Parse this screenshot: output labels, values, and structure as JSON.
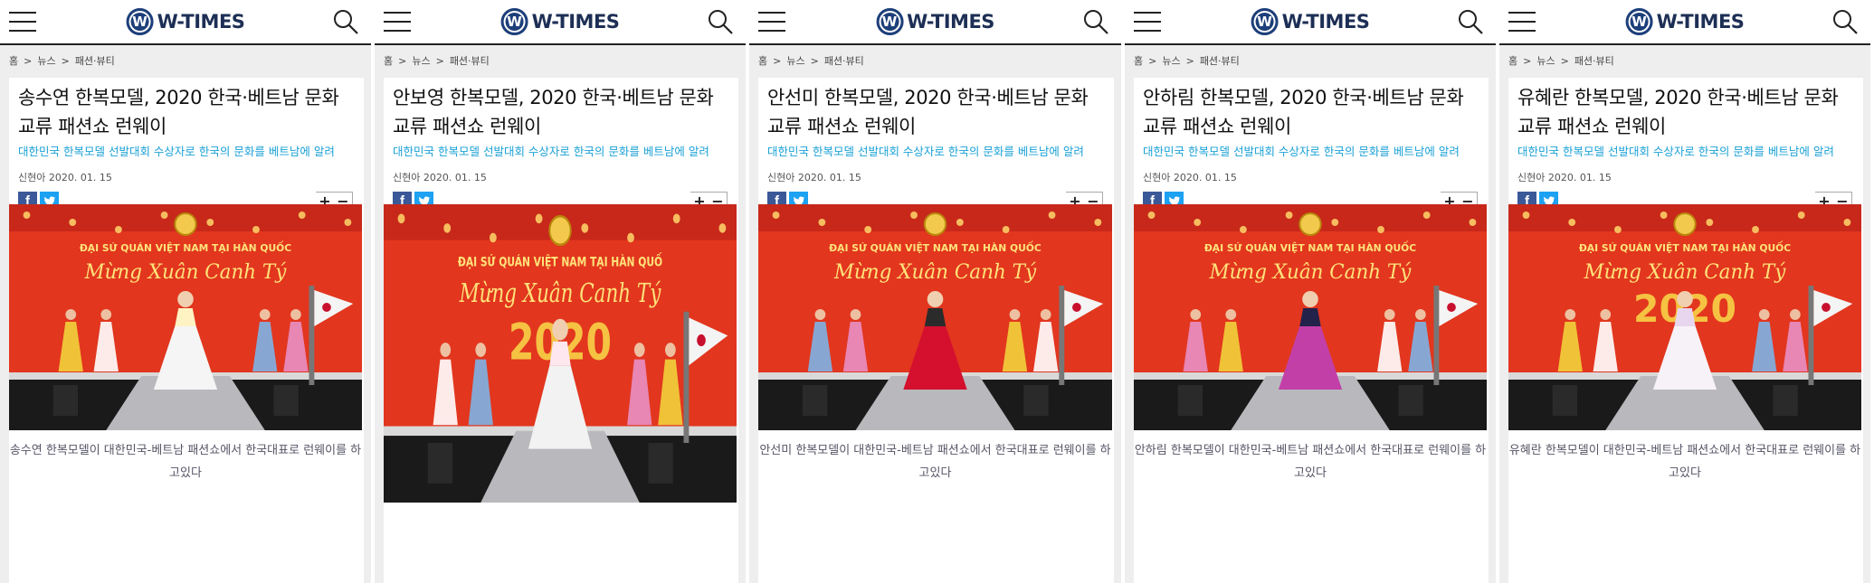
{
  "site": {
    "logo_text": "W-TIMES",
    "logo_mark": "W"
  },
  "breadcrumb": [
    "홈",
    "뉴스",
    "패션·뷰티"
  ],
  "breadcrumb_sep": ">",
  "font_controls": {
    "plus": "+",
    "minus": "−"
  },
  "colors": {
    "accent": "#1aa1d6",
    "brand": "#1d3f7a",
    "facebook": "#3b5998",
    "twitter": "#1da1f2"
  },
  "articles": [
    {
      "title": "송수연 한복모델, 2020 한국·베트남 문화교류 패션쇼 런웨이",
      "subtitle": "대한민국 한복모델 선발대회 수상자로 한국의 문화를 베트남에 알려",
      "byline": "신현아 2020. 01. 15",
      "caption": "송수연 한복모델이 대한민국-베트남 패션쇼에서 한국대표로 런웨이를 하고있다",
      "photo_banner": "ĐẠI SỨ QUÁN VIỆT NAM TẠI HÀN QUỐC",
      "photo_script": "Mừng Xuân Canh Tý"
    },
    {
      "title": "안보영 한복모델, 2020 한국·베트남 문화교류 패션쇼 런웨이",
      "subtitle": "대한민국 한복모델 선발대회 수상자로 한국의 문화를 베트남에 알려",
      "byline": "신현아 2020. 01. 15",
      "caption": "",
      "photo_banner": "ĐẠI SỨ QUÁN VIỆT NAM TẠI HÀN QUỐ",
      "photo_script": "Mừng Xuân Canh Tý",
      "photo_year": "2020"
    },
    {
      "title": "안선미 한복모델, 2020 한국·베트남 문화교류 패션쇼 런웨이",
      "subtitle": "대한민국 한복모델 선발대회 수상자로 한국의 문화를 베트남에 알려",
      "byline": "신현아 2020. 01. 15",
      "caption": "안선미 한복모델이 대한민국-베트남 패션쇼에서 한국대표로 런웨이를 하고있다",
      "photo_banner": "ĐẠI SỨ QUÁN VIỆT NAM TẠI HÀN QUỐC",
      "photo_script": "Mừng Xuân Canh Tý"
    },
    {
      "title": "안하림 한복모델, 2020 한국·베트남 문화교류 패션쇼 런웨이",
      "subtitle": "대한민국 한복모델 선발대회 수상자로 한국의 문화를 베트남에 알려",
      "byline": "신현아 2020. 01. 15",
      "caption": "안하림 한복모델이 대한민국-베트남 패션쇼에서 한국대표로 런웨이를 하고있다",
      "photo_banner": "ĐẠI SỨ QUÁN VIỆT NAM TẠI HÀN QUỐC",
      "photo_script": "Mừng Xuân Canh Tý"
    },
    {
      "title": "유혜란 한복모델, 2020 한국·베트남 문화교류 패션쇼 런웨이",
      "subtitle": "대한민국 한복모델 선발대회 수상자로 한국의 문화를 베트남에 알려",
      "byline": "신현아 2020. 01. 15",
      "caption": "유혜란 한복모델이 대한민국-베트남 패션쇼에서 한국대표로 런웨이를 하고있다",
      "photo_banner": "ĐẠI SỨ QUÁN VIỆT NAM TẠI HÀN QUỐC",
      "photo_script": "Mừng Xuân Canh Tý",
      "photo_year": "2020"
    }
  ]
}
